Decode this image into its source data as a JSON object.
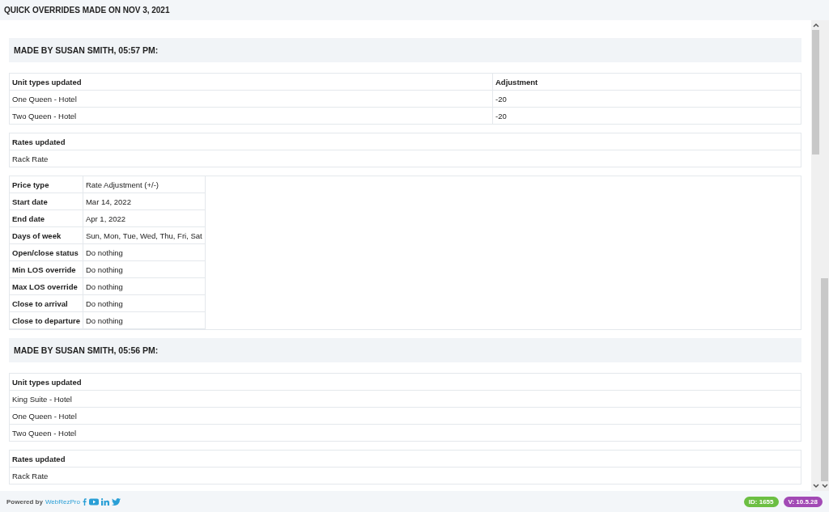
{
  "page_title": "QUICK OVERRIDES MADE ON NOV 3, 2021",
  "sections": [
    {
      "heading": "MADE BY SUSAN SMITH, 05:57 PM:",
      "unit_table": {
        "columns": [
          "Unit types updated",
          "Adjustment"
        ],
        "rows": [
          [
            "One Queen - Hotel",
            "-20"
          ],
          [
            "Two Queen - Hotel",
            "-20"
          ]
        ]
      },
      "rates_table": {
        "heading": "Rates updated",
        "rows": [
          "Rack Rate"
        ]
      },
      "details": [
        {
          "label": "Price type",
          "value": "Rate Adjustment (+/-)"
        },
        {
          "label": "Start date",
          "value": "Mar 14, 2022"
        },
        {
          "label": "End date",
          "value": "Apr 1, 2022"
        },
        {
          "label": "Days of week",
          "value": "Sun, Mon, Tue, Wed, Thu, Fri, Sat"
        },
        {
          "label": "Open/close status",
          "value": "Do nothing"
        },
        {
          "label": "Min LOS override",
          "value": "Do nothing"
        },
        {
          "label": "Max LOS override",
          "value": "Do nothing"
        },
        {
          "label": "Close to arrival",
          "value": "Do nothing"
        },
        {
          "label": "Close to departure",
          "value": "Do nothing"
        }
      ]
    },
    {
      "heading": "MADE BY SUSAN SMITH, 05:56 PM:",
      "unit_table": {
        "columns": [
          "Unit types updated"
        ],
        "rows": [
          [
            "King Suite - Hotel"
          ],
          [
            "One Queen - Hotel"
          ],
          [
            "Two Queen - Hotel"
          ]
        ]
      },
      "rates_table": {
        "heading": "Rates updated",
        "rows": [
          "Rack Rate"
        ]
      }
    }
  ],
  "footer": {
    "powered_by": "Powered by",
    "brand": "WebRezPro",
    "id_badge": "ID: 1655",
    "version_badge": "V: 10.5.28"
  }
}
